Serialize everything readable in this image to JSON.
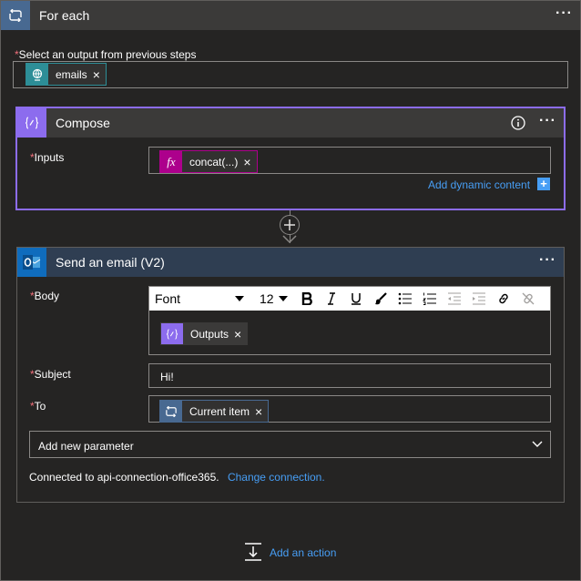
{
  "foreach": {
    "title": "For each",
    "output_label": "Select an output from previous steps",
    "token": {
      "label": "emails",
      "icon": "globe-dynamic-icon",
      "color": "#2d8e97"
    }
  },
  "compose": {
    "title": "Compose",
    "inputs_label": "Inputs",
    "token": {
      "label": "concat(...)",
      "icon": "fx-icon",
      "color": "#ad008c"
    },
    "add_dynamic": "Add dynamic content",
    "accent": "#8c6cee"
  },
  "email": {
    "title": "Send an email (V2)",
    "body_label": "Body",
    "toolbar": {
      "font": "Font",
      "size": "12"
    },
    "body_token": {
      "label": "Outputs",
      "icon": "compose-icon",
      "color": "#8c6cee"
    },
    "subject_label": "Subject",
    "subject_value": "Hi!",
    "to_label": "To",
    "to_token": {
      "label": "Current item",
      "icon": "loop-icon",
      "color": "#486991"
    },
    "add_param": "Add new parameter",
    "connected_text": "Connected to api-connection-office365.",
    "change_connection": "Change connection."
  },
  "required_mark": "*",
  "add_action": "Add an action",
  "colors": {
    "link": "#479ef5",
    "required": "#f1707b",
    "foreach_header": "#3b3a39",
    "email_header": "#2f3e52"
  }
}
